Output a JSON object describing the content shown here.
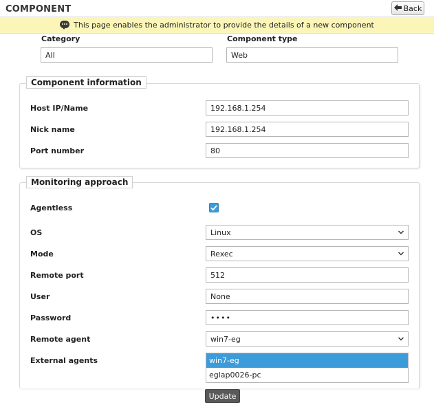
{
  "header": {
    "title": "COMPONENT",
    "back_label": "Back",
    "back_icon": "back-arrow-icon"
  },
  "info": {
    "icon": "chat-bubble-icon",
    "text": "This page enables the administrator to provide the details of a new component"
  },
  "selectors": {
    "category_label": "Category",
    "category_value": "All",
    "component_type_label": "Component type",
    "component_type_value": "Web"
  },
  "component_info": {
    "legend": "Component information",
    "host_label": "Host IP/Name",
    "host_value": "192.168.1.254",
    "nick_label": "Nick name",
    "nick_value": "192.168.1.254",
    "port_label": "Port number",
    "port_value": "80"
  },
  "monitoring": {
    "legend": "Monitoring approach",
    "agentless_label": "Agentless",
    "agentless_checked": true,
    "os_label": "OS",
    "os_value": "Linux",
    "mode_label": "Mode",
    "mode_value": "Rexec",
    "remote_port_label": "Remote port",
    "remote_port_value": "512",
    "user_label": "User",
    "user_value": "None",
    "password_label": "Password",
    "password_value": "••••",
    "remote_agent_label": "Remote agent",
    "remote_agent_value": "win7-eg",
    "external_agents_label": "External agents",
    "external_agents_options": [
      "win7-eg",
      "eglap0026-pc"
    ],
    "external_agents_selected": "win7-eg"
  },
  "footer": {
    "update_label": "Update"
  },
  "colors": {
    "info_bg": "#fbf6b8",
    "accent": "#3c9bd8",
    "update_bg": "#595959"
  }
}
